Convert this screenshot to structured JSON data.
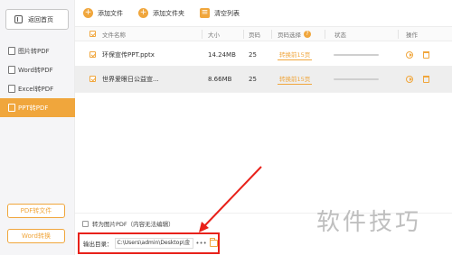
{
  "sidebar": {
    "home_label": "返回首页",
    "items": [
      {
        "label": "图片转PDF",
        "active": false
      },
      {
        "label": "Word转PDF",
        "active": false
      },
      {
        "label": "Excel转PDF",
        "active": false
      },
      {
        "label": "PPT转PDF",
        "active": true
      }
    ],
    "pdf_to_file_label": "PDF转文件",
    "word_label": "Word转换"
  },
  "toolbar": {
    "add_file_label": "添加文件",
    "add_folder_label": "添加文件夹",
    "clear_list_label": "清空列表"
  },
  "table": {
    "headers": {
      "name": "文件名称",
      "size": "大小",
      "pages": "页码",
      "page_select": "页码选择",
      "status": "状态",
      "ops": "操作"
    },
    "help_badge": "?",
    "rows": [
      {
        "name": "环保宣传PPT.pptx",
        "size": "14.24MB",
        "pages": "25",
        "range": "转换前15页",
        "progress": 0
      },
      {
        "name": "世界爱眼日公益宣...",
        "size": "8.66MB",
        "pages": "25",
        "range": "转换前15页",
        "progress": 0
      }
    ]
  },
  "bottom": {
    "to_image_label": "转为图片PDF（内容无法编辑）",
    "output_label": "输出目录：",
    "output_path": "C:\\Users\\admin\\Desktop\\金",
    "more": "•••"
  },
  "watermark": "软件技巧",
  "colors": {
    "accent": "#f0a63c",
    "highlight_box": "#e8211a"
  }
}
